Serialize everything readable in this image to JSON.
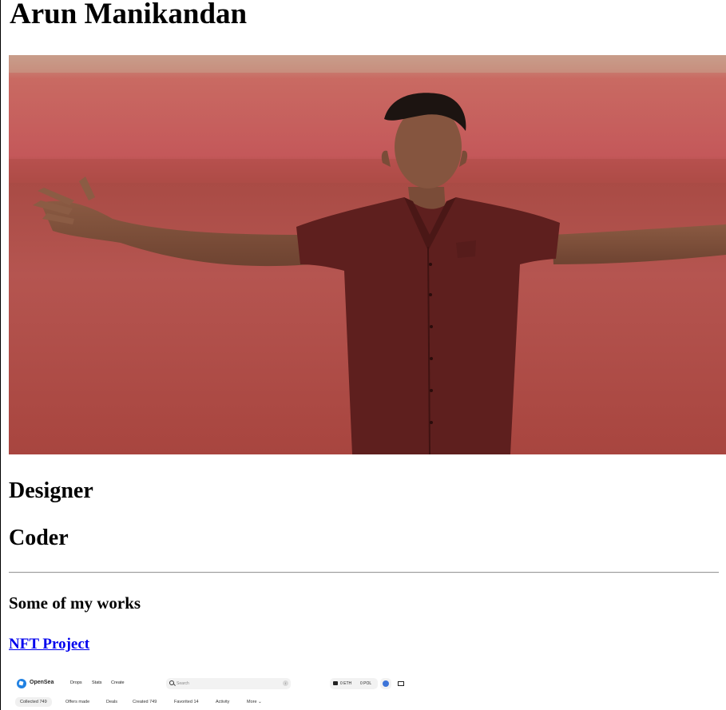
{
  "header": {
    "name": "Arun Manikandan"
  },
  "hero_image": {
    "description_icon": "portrait-photo-icon"
  },
  "roles": {
    "first": "Designer",
    "second": "Coder"
  },
  "works": {
    "heading": "Some of my works",
    "link_label": "NFT Project"
  },
  "preview": {
    "brand": "OpenSea",
    "nav": [
      "Drops",
      "Stats",
      "Create"
    ],
    "search_placeholder": "Search",
    "search_shortcut": "/",
    "wallet_eth": "0 ETH",
    "wallet_pol": "0 POL",
    "tabs": [
      "Collected 749",
      "Offers made",
      "Deals",
      "Created 749",
      "Favorited 14",
      "Activity",
      "More"
    ]
  },
  "colors": {
    "link": "#0000ee",
    "hero_background": "#c45858",
    "shirt": "#5e1f1e",
    "opensea_blue": "#2081e2"
  }
}
